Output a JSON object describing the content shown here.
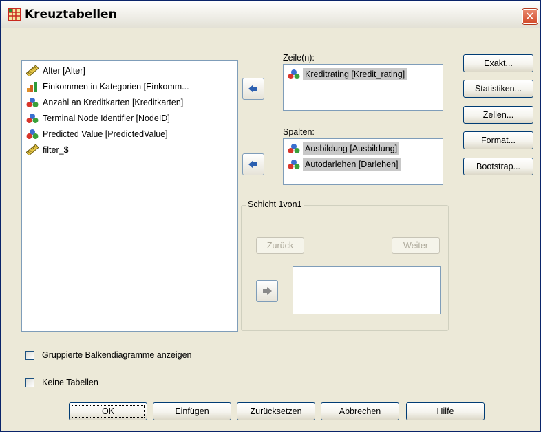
{
  "window": {
    "title": "Kreuztabellen",
    "close_glyph": "✕"
  },
  "variables": [
    {
      "label": "Alter [Alter]",
      "icon": "ruler-scale-icon"
    },
    {
      "label": "Einkommen in Kategorien [Einkomm...",
      "icon": "ordinal-bars-icon"
    },
    {
      "label": "Anzahl an Kreditkarten [Kreditkarten]",
      "icon": "nominal-balls-icon"
    },
    {
      "label": "Terminal Node Identifier [NodeID]",
      "icon": "nominal-balls-icon"
    },
    {
      "label": "Predicted Value [PredictedValue]",
      "icon": "nominal-balls-icon"
    },
    {
      "label": "filter_$",
      "icon": "ruler-scale-icon"
    }
  ],
  "rows": {
    "label": "Zeile(n):",
    "items": [
      "Kreditrating [Kredit_rating]"
    ]
  },
  "columns": {
    "label": "Spalten:",
    "items": [
      "Ausbildung [Ausbildung]",
      "Autodarlehen [Darlehen]"
    ]
  },
  "layer": {
    "title": "Schicht 1von1",
    "back_label": "Zurück",
    "next_label": "Weiter"
  },
  "side_buttons": [
    "Exakt...",
    "Statistiken...",
    "Zellen...",
    "Format...",
    "Bootstrap..."
  ],
  "options": {
    "clustered_bars": "Gruppierte Balkendiagramme anzeigen",
    "no_tables": "Keine Tabellen"
  },
  "bottom_buttons": {
    "ok": "OK",
    "paste": "Einfügen",
    "reset": "Zurücksetzen",
    "cancel": "Abbrechen",
    "help": "Hilfe"
  },
  "colors": {
    "accent": "#003c74",
    "selection": "#c8c8c8",
    "close": "#d24a2a"
  }
}
